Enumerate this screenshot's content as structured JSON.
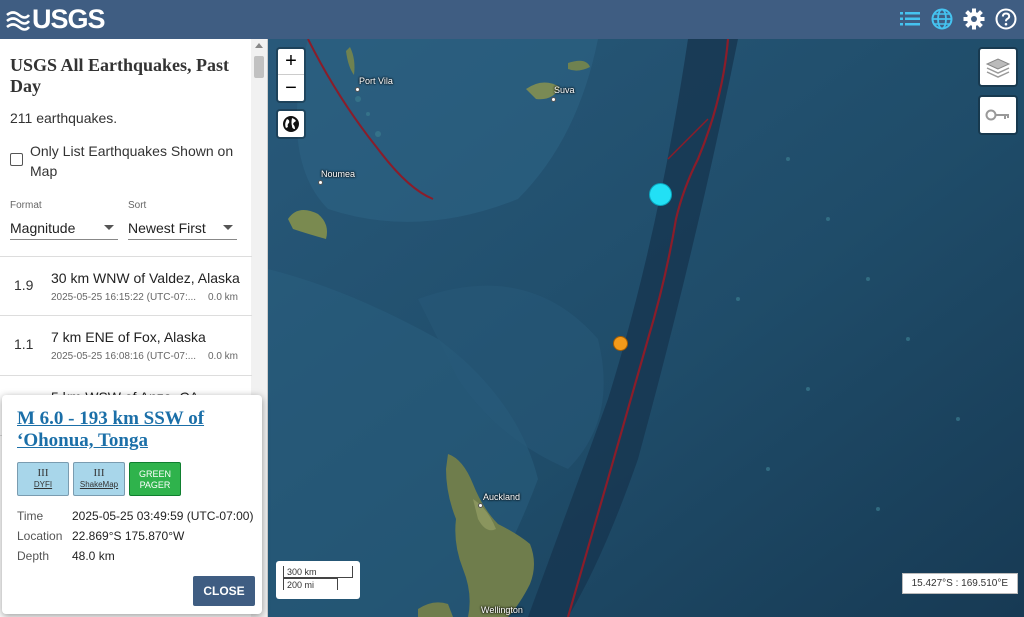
{
  "header": {
    "logo": "USGS",
    "icons": [
      "list-icon",
      "globe-icon",
      "gear-icon",
      "help-icon"
    ]
  },
  "sidebar": {
    "title": "USGS All Earthquakes, Past Day",
    "count": "211 earthquakes.",
    "only_list_label": "Only List Earthquakes Shown on Map",
    "format": {
      "label": "Format",
      "value": "Magnitude"
    },
    "sort": {
      "label": "Sort",
      "value": "Newest First"
    },
    "earthquakes": [
      {
        "mag": "1.9",
        "place": "30 km WNW of Valdez, Alaska",
        "time": "2025-05-25 16:15:22 (UTC-07:...",
        "depth": "0.0 km"
      },
      {
        "mag": "1.1",
        "place": "7 km ENE of Fox, Alaska",
        "time": "2025-05-25 16:08:16 (UTC-07:...",
        "depth": "0.0 km"
      },
      {
        "mag": "",
        "place": "5 km WSW of Anza, CA",
        "time": "",
        "depth": ""
      }
    ]
  },
  "map": {
    "zoom_in": "+",
    "zoom_out": "−",
    "cities": {
      "port_vila": "Port Vila",
      "suva": "Suva",
      "noumea": "Noumea",
      "auckland": "Auckland",
      "wellington": "Wellington"
    },
    "scale": {
      "km": "300 km",
      "mi": "200 mi"
    },
    "coordinates": "15.427°S : 169.510°E",
    "colors": {
      "ocean": "#1d4660",
      "plate_boundary": "#8a1d2a",
      "marker_cyan": "#22e0f5",
      "marker_orange": "#f39a1a"
    }
  },
  "popup": {
    "title": "M 6.0 - 193 km SSW of ‘Ohonua, Tonga",
    "dyfi": {
      "level": "III",
      "label": "DYFI"
    },
    "shakemap": {
      "level": "III",
      "label": "ShakeMap"
    },
    "pager": {
      "level": "GREEN",
      "label": "PAGER"
    },
    "time_label": "Time",
    "time_value": "2025-05-25 03:49:59 (UTC-07:00)",
    "location_label": "Location",
    "location_value": "22.869°S 175.870°W",
    "depth_label": "Depth",
    "depth_value": "48.0 km",
    "close_label": "CLOSE"
  }
}
